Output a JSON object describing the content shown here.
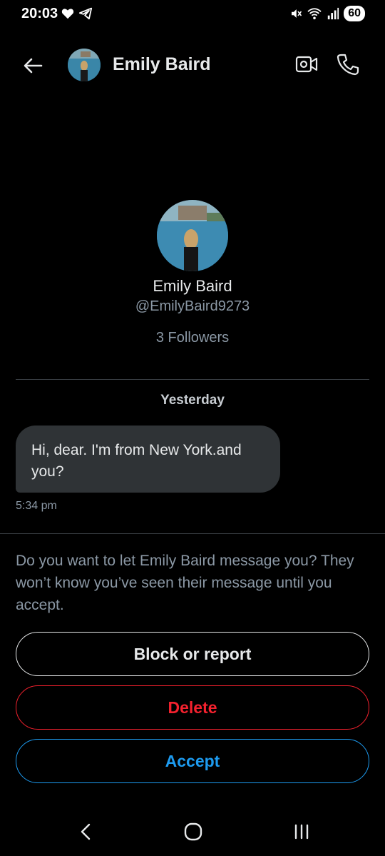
{
  "status_bar": {
    "time": "20:03",
    "battery": "60"
  },
  "header": {
    "name": "Emily Baird"
  },
  "profile": {
    "name": "Emily Baird",
    "handle": "@EmilyBaird9273",
    "followers": "3 Followers"
  },
  "conversation": {
    "date_separator": "Yesterday",
    "messages": [
      {
        "text": "Hi, dear. I'm from New York.and you?",
        "time": "5:34 pm"
      }
    ]
  },
  "request": {
    "prompt": "Do you want to let Emily Baird message you? They won’t know you’ve seen their message until you accept.",
    "block_label": "Block or report",
    "delete_label": "Delete",
    "accept_label": "Accept"
  },
  "colors": {
    "background": "#000000",
    "bubble": "#2f3336",
    "accept": "#1d9bf0",
    "delete": "#f4212e",
    "secondary_text": "#8b98a5"
  },
  "icons": [
    "heart-icon",
    "telegram-icon",
    "mute-icon",
    "wifi-icon",
    "signal-icon",
    "back-arrow-icon",
    "video-call-icon",
    "phone-icon",
    "nav-back-icon",
    "nav-home-icon",
    "nav-recents-icon"
  ]
}
